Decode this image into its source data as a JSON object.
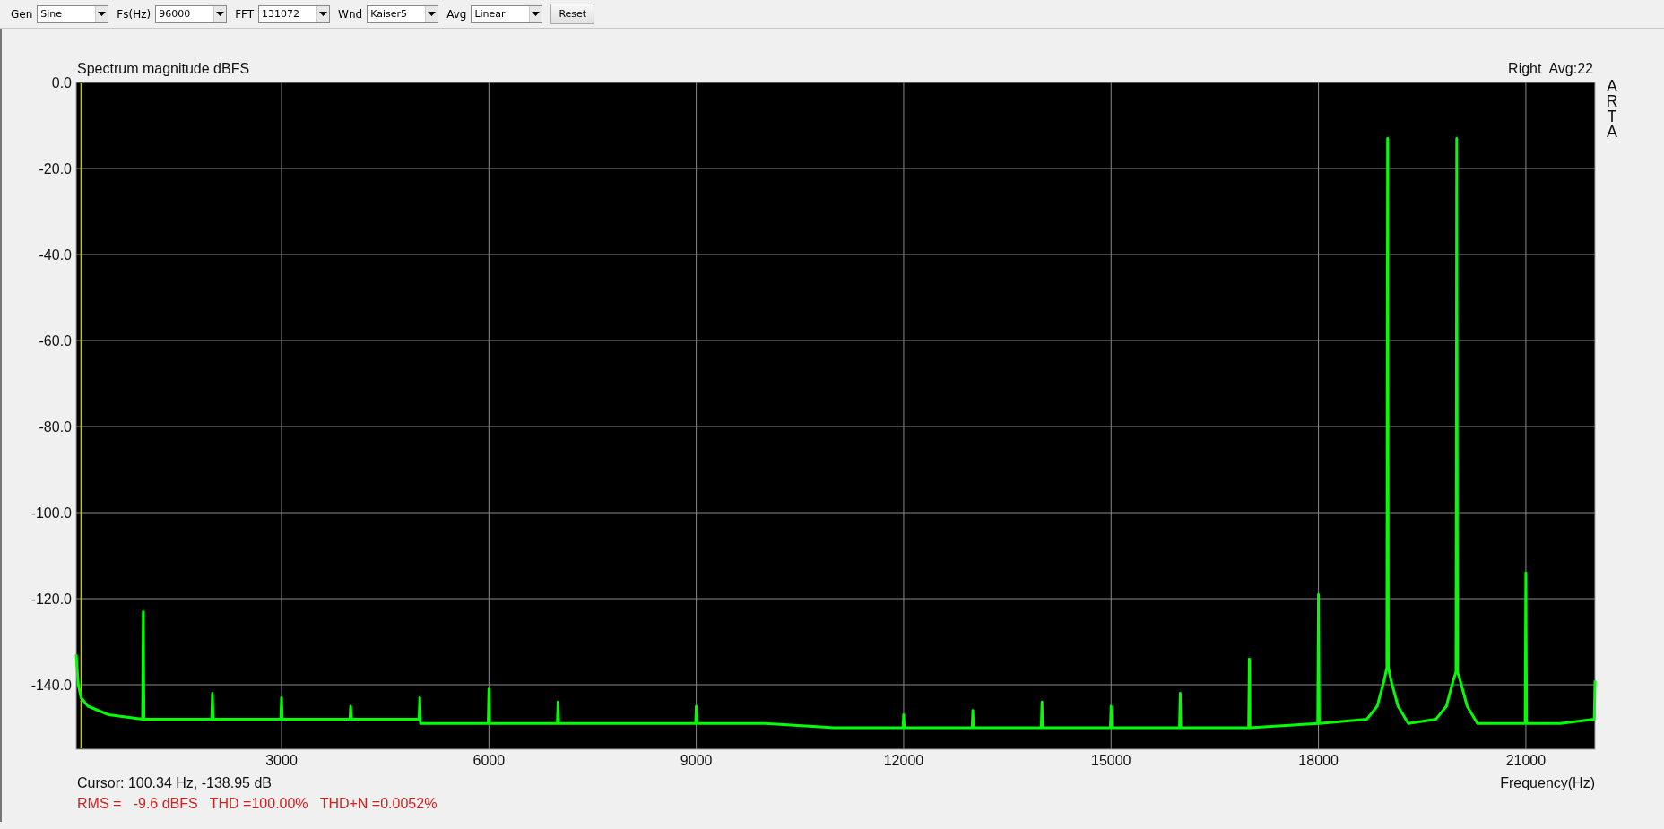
{
  "toolbar": {
    "controls": [
      {
        "kind": "dropdown",
        "label": "Gen",
        "value": "Sine"
      },
      {
        "kind": "dropdown",
        "label": "Fs(Hz)",
        "value": "96000"
      },
      {
        "kind": "dropdown",
        "label": "FFT",
        "value": "131072"
      },
      {
        "kind": "dropdown",
        "label": "Wnd",
        "value": "Kaiser5"
      },
      {
        "kind": "dropdown",
        "label": "Avg",
        "value": "Linear"
      },
      {
        "kind": "button",
        "label": "Reset"
      }
    ]
  },
  "plot": {
    "title": "Spectrum magnitude dBFS",
    "channel": "Right",
    "average": "Avg:22",
    "brand": "ARTA",
    "chart_data": {
      "type": "line",
      "grid": true,
      "xlabel": "Frequency(Hz)",
      "xlim": [
        30,
        22000
      ],
      "ylim": [
        -155,
        0
      ],
      "xticks": [
        3000,
        6000,
        9000,
        12000,
        15000,
        18000,
        21000
      ],
      "yticks": [
        {
          "value": 0,
          "label": "0.0"
        },
        {
          "value": -20,
          "label": "-20.0"
        },
        {
          "value": -40,
          "label": "-40.0"
        },
        {
          "value": -60,
          "label": "-60.0"
        },
        {
          "value": -80,
          "label": "-80.0"
        },
        {
          "value": -100,
          "label": "-100.0"
        },
        {
          "value": -120,
          "label": "-120.0"
        },
        {
          "value": -140,
          "label": "-140.0"
        }
      ],
      "x": [
        30,
        60,
        100,
        200,
        500,
        990,
        1000,
        1010,
        1990,
        2000,
        2010,
        2990,
        3000,
        3010,
        3990,
        4000,
        4010,
        4990,
        5000,
        5010,
        5990,
        6000,
        6010,
        6990,
        7000,
        7010,
        8000,
        8990,
        9000,
        9010,
        10000,
        11000,
        11990,
        12000,
        12010,
        12990,
        13000,
        13010,
        13990,
        14000,
        14010,
        14990,
        15000,
        15010,
        15990,
        16000,
        16010,
        16990,
        17000,
        17010,
        17990,
        18000,
        18010,
        18700,
        18850,
        18950,
        18990,
        19000,
        19010,
        19050,
        19150,
        19300,
        19700,
        19850,
        19950,
        19990,
        20000,
        20010,
        20050,
        20150,
        20300,
        20990,
        21000,
        21010,
        21500,
        21990,
        22000
      ],
      "series": [
        {
          "color": "#00ff00",
          "values": [
            -133,
            -140,
            -143,
            -145,
            -147,
            -148,
            -123,
            -148,
            -148,
            -142,
            -148,
            -148,
            -143,
            -148,
            -148,
            -145,
            -148,
            -148,
            -143,
            -149,
            -149,
            -141,
            -149,
            -149,
            -144,
            -149,
            -149,
            -149,
            -145,
            -149,
            -149,
            -150,
            -150,
            -147,
            -150,
            -150,
            -146,
            -150,
            -150,
            -144,
            -150,
            -150,
            -145,
            -150,
            -150,
            -142,
            -150,
            -150,
            -134,
            -150,
            -149,
            -119,
            -149,
            -148,
            -145,
            -139,
            -136,
            -13,
            -136,
            -139,
            -145,
            -149,
            -148,
            -145,
            -139,
            -137,
            -13,
            -137,
            -139,
            -145,
            -149,
            -149,
            -114,
            -149,
            -149,
            -148,
            -139
          ]
        }
      ],
      "ref_lines": [
        {
          "axis": "x",
          "value": 100.34
        }
      ]
    },
    "cursor": "Cursor: 100.34 Hz, -138.95 dB",
    "stats": [
      "RMS =   -9.6 dBFS",
      "THD =100.00%",
      "THD+N =0.0052%"
    ]
  }
}
